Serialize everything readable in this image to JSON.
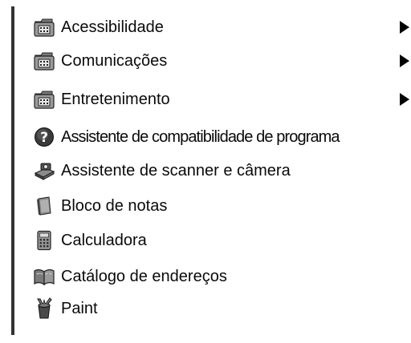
{
  "menu": {
    "items": [
      {
        "label": "Acessibilidade",
        "icon": "program-group-folder-icon",
        "submenu": true
      },
      {
        "label": "Comunicações",
        "icon": "program-group-folder-icon",
        "submenu": true
      },
      {
        "label": "Entretenimento",
        "icon": "program-group-folder-icon",
        "submenu": true
      },
      {
        "label": "Assistente de compatibilidade de programa",
        "icon": "help-question-icon",
        "submenu": false
      },
      {
        "label": "Assistente de scanner e câmera",
        "icon": "scanner-camera-icon",
        "submenu": false
      },
      {
        "label": "Bloco de notas",
        "icon": "notepad-icon",
        "submenu": false
      },
      {
        "label": "Calculadora",
        "icon": "calculator-icon",
        "submenu": false
      },
      {
        "label": "Catálogo de endereços",
        "icon": "address-book-icon",
        "submenu": false
      },
      {
        "label": "Paint",
        "icon": "paint-icon",
        "submenu": false
      }
    ]
  }
}
